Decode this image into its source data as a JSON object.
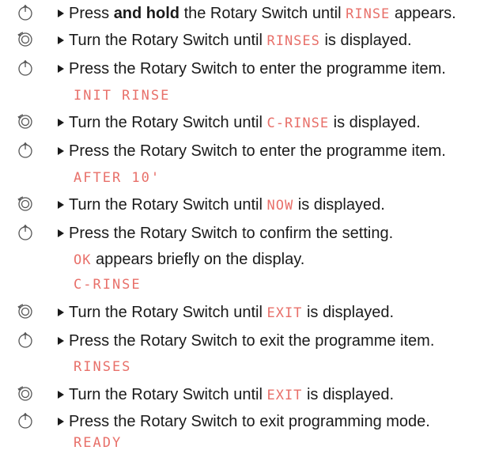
{
  "steps": [
    {
      "icon": "press-icon",
      "pre": "Press ",
      "bold": "and hold",
      "mid": " the Rotary Switch until ",
      "code": "RINSE",
      "post": " appears."
    },
    {
      "icon": "turn-icon",
      "pre": "Turn the Rotary Switch until ",
      "code": "RINSES",
      "post": " is displayed."
    },
    {
      "icon": "press-icon",
      "pre": "Press the Rotary Switch to enter the programme item.",
      "display": "INIT RINSE"
    },
    {
      "icon": "turn-icon",
      "pre": "Turn the Rotary Switch until ",
      "code": "C-RINSE",
      "post": " is displayed."
    },
    {
      "icon": "press-icon",
      "pre": "Press the Rotary Switch to enter the programme item.",
      "display": "AFTER 10'"
    },
    {
      "icon": "turn-icon",
      "pre": "Turn the Rotary Switch until ",
      "code": "NOW",
      "post": " is displayed."
    },
    {
      "icon": "press-icon",
      "pre": "Press the Rotary Switch to confirm the setting.",
      "note_code": "OK",
      "note_text": " appears briefly on the display.",
      "display": "C-RINSE"
    },
    {
      "icon": "turn-icon",
      "pre": "Turn the Rotary Switch until ",
      "code": "EXIT",
      "post": " is displayed."
    },
    {
      "icon": "press-icon",
      "pre": "Press the Rotary Switch to exit the programme item.",
      "display": "RINSES"
    },
    {
      "icon": "turn-icon",
      "pre": "Turn the Rotary Switch until ",
      "code": "EXIT",
      "post": " is displayed."
    },
    {
      "icon": "press-icon",
      "pre": "Press the Rotary Switch to exit programming mode.",
      "display": "READY"
    }
  ],
  "colors": {
    "display_text": "#e8706a",
    "body_text": "#1a1a1a",
    "icon": "#555555"
  }
}
